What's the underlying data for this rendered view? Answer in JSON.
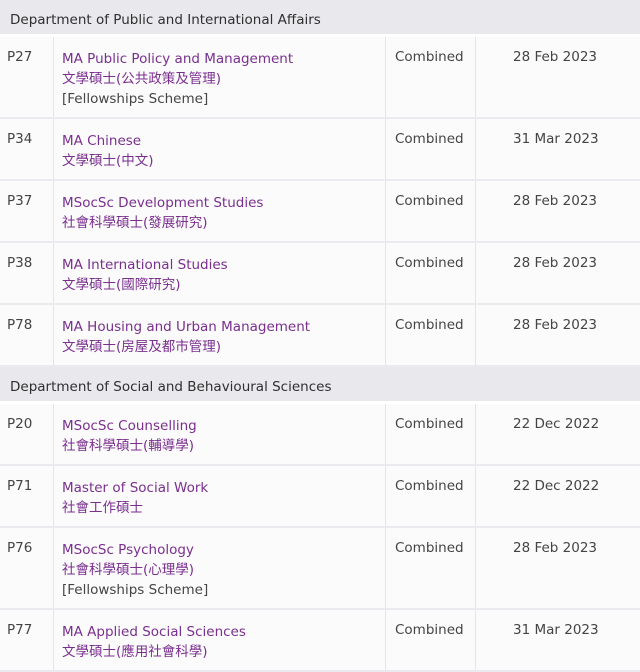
{
  "departments": [
    {
      "name": "Department of Public and International Affairs",
      "rows": [
        {
          "code": "P27",
          "title_en": "MA Public Policy and Management",
          "title_zh": "文學碩士(公共政策及管理)",
          "note": "[Fellowships Scheme]",
          "mode": "Combined",
          "date": "28 Feb 2023"
        },
        {
          "code": "P34",
          "title_en": "MA Chinese",
          "title_zh": "文學碩士(中文)",
          "note": "",
          "mode": "Combined",
          "date": "31 Mar 2023"
        },
        {
          "code": "P37",
          "title_en": "MSocSc Development Studies",
          "title_zh": "社會科學碩士(發展研究)",
          "note": "",
          "mode": "Combined",
          "date": "28 Feb 2023"
        },
        {
          "code": "P38",
          "title_en": "MA International Studies",
          "title_zh": "文學碩士(國際研究)",
          "note": "",
          "mode": "Combined",
          "date": "28 Feb 2023"
        },
        {
          "code": "P78",
          "title_en": "MA Housing and Urban Management",
          "title_zh": "文學碩士(房屋及都市管理)",
          "note": "",
          "mode": "Combined",
          "date": "28 Feb 2023"
        }
      ]
    },
    {
      "name": "Department of Social and Behavioural Sciences",
      "rows": [
        {
          "code": "P20",
          "title_en": "MSocSc Counselling",
          "title_zh": "社會科學碩士(輔導學)",
          "note": "",
          "mode": "Combined",
          "date": "22 Dec 2022"
        },
        {
          "code": "P71",
          "title_en": "Master of Social Work",
          "title_zh": "社會工作碩士",
          "note": "",
          "mode": "Combined",
          "date": "22 Dec 2022"
        },
        {
          "code": "P76",
          "title_en": "MSocSc Psychology",
          "title_zh": "社會科學碩士(心理學)",
          "note": "[Fellowships Scheme]",
          "mode": "Combined",
          "date": "28 Feb 2023"
        },
        {
          "code": "P77",
          "title_en": "MA Applied Social Sciences",
          "title_zh": "文學碩士(應用社會科學)",
          "note": "",
          "mode": "Combined",
          "date": "31 Mar 2023"
        }
      ]
    }
  ]
}
